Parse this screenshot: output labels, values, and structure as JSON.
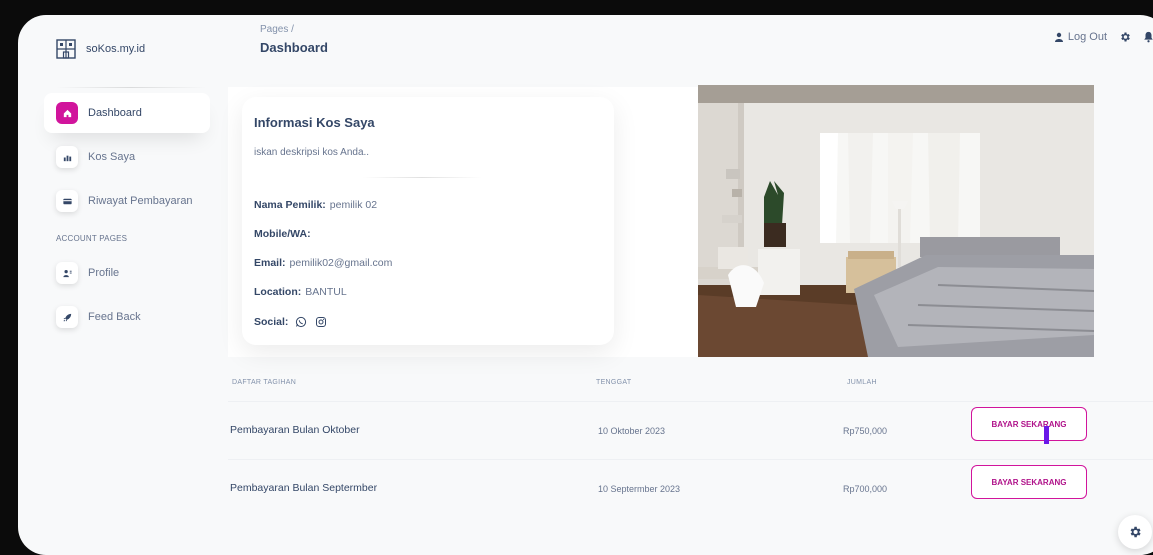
{
  "brand": {
    "name": "soKos.my.id",
    "icon": "building-grid-icon"
  },
  "sidebar": {
    "items": [
      {
        "label": "Dashboard",
        "icon": "home-icon",
        "active": true
      },
      {
        "label": "Kos Saya",
        "icon": "chart-icon",
        "active": false
      },
      {
        "label": "Riwayat Pembayaran",
        "icon": "credit-card-icon",
        "active": false
      }
    ],
    "section_title": "ACCOUNT PAGES",
    "account_items": [
      {
        "label": "Profile",
        "icon": "user-icon"
      },
      {
        "label": "Feed Back",
        "icon": "rocket-icon"
      }
    ]
  },
  "header": {
    "breadcrumb": "Pages /",
    "title": "Dashboard",
    "logout_label": "Log Out"
  },
  "info": {
    "title": "Informasi Kos Saya",
    "description": "iskan deskripsi kos Anda..",
    "owner_label": "Nama Pemilik:",
    "owner_value": "pemilik 02",
    "mobile_label": "Mobile/WA:",
    "mobile_value": "",
    "email_label": "Email:",
    "email_value": "pemilik02@gmail.com",
    "location_label": "Location:",
    "location_value": "BANTUL",
    "social_label": "Social:"
  },
  "table": {
    "headers": [
      "DAFTAR TAGIHAN",
      "TENGGAT",
      "JUMLAH"
    ],
    "rows": [
      {
        "title": "Pembayaran Bulan Oktober",
        "due": "10 Oktober 2023",
        "amount": "Rp750,000",
        "button": "BAYAR SEKARANG"
      },
      {
        "title": "Pembayaran Bulan Septermber",
        "due": "10 Septermber 2023",
        "amount": "Rp700,000",
        "button": "BAYAR SEKARANG"
      }
    ]
  },
  "colors": {
    "accent": "#d1149c",
    "text": "#344767",
    "muted": "#67748e"
  }
}
